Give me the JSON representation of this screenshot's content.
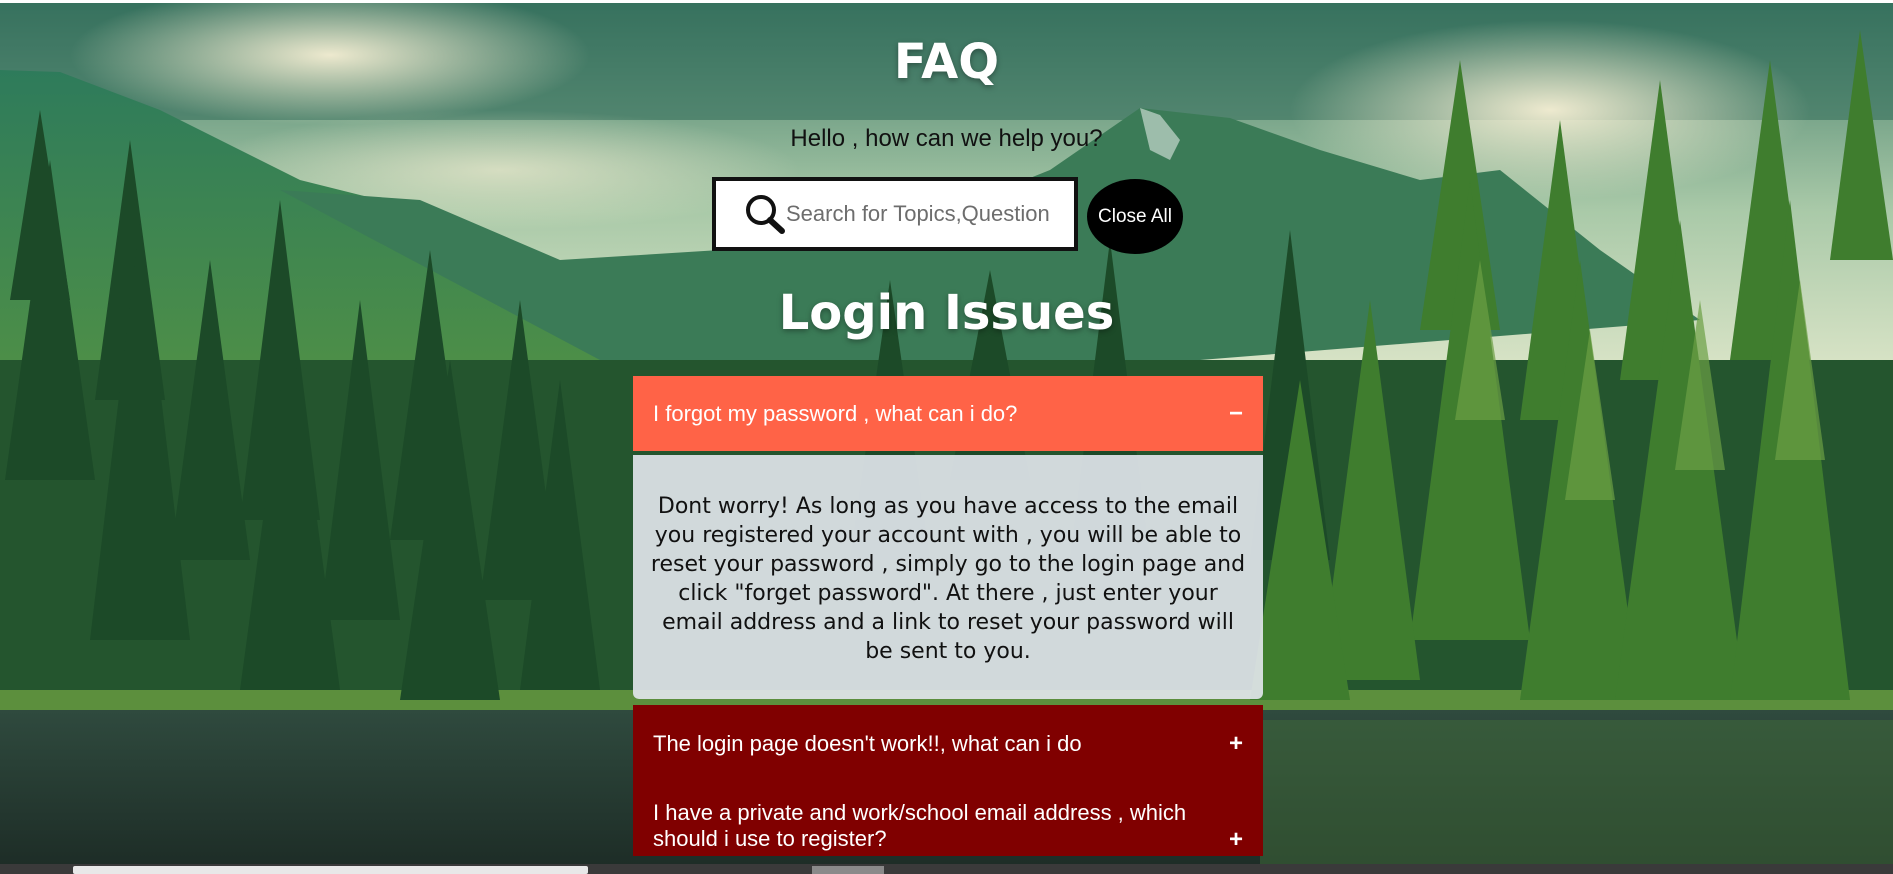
{
  "header": {
    "title": "FAQ",
    "subtitle": "Hello , how can we help you?"
  },
  "search": {
    "placeholder": "Search for Topics,Question",
    "icon": "search-icon"
  },
  "close_all_label": "Close All",
  "section": {
    "title": "Login Issues"
  },
  "faq_items": [
    {
      "question": "I forgot my password , what can i do?",
      "toggle": "−",
      "state": "open",
      "answer": "Dont worry! As long as you have access to the email you registered your account with , you will be able to reset your password , simply go to the login page and click \"forget password\". At there , just enter your email address and a link to reset your password will be sent to you."
    },
    {
      "question": "The login page doesn't work!!, what can i do",
      "toggle": "+",
      "state": "closed"
    },
    {
      "question": "I have a private and work/school email address , which should i use to register?",
      "toggle": "+",
      "state": "closed"
    }
  ],
  "colors": {
    "open_header": "#ff6347",
    "closed_header": "#800000",
    "answer_bg": "#e4e8ee",
    "close_all_bg": "#000000"
  }
}
